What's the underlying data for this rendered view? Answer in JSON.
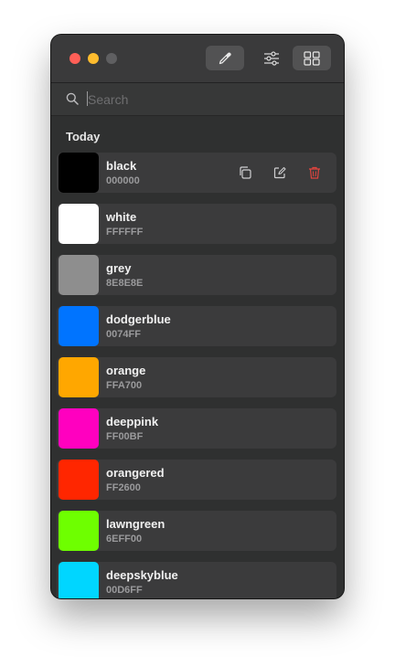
{
  "search": {
    "placeholder": "Search",
    "value": ""
  },
  "section": {
    "title": "Today"
  },
  "colors": [
    {
      "name": "black",
      "hex": "000000",
      "swatch": "#000000"
    },
    {
      "name": "white",
      "hex": "FFFFFF",
      "swatch": "#FFFFFF"
    },
    {
      "name": "grey",
      "hex": "8E8E8E",
      "swatch": "#8E8E8E"
    },
    {
      "name": "dodgerblue",
      "hex": "0074FF",
      "swatch": "#0074FF"
    },
    {
      "name": "orange",
      "hex": "FFA700",
      "swatch": "#FFA700"
    },
    {
      "name": "deeppink",
      "hex": "FF00BF",
      "swatch": "#FF00BF"
    },
    {
      "name": "orangered",
      "hex": "FF2600",
      "swatch": "#FF2600"
    },
    {
      "name": "lawngreen",
      "hex": "6EFF00",
      "swatch": "#6EFF00"
    },
    {
      "name": "deepskyblue",
      "hex": "00D6FF",
      "swatch": "#00D6FF"
    }
  ],
  "icons": {
    "toolbar": [
      "eyedropper-icon",
      "sliders-icon",
      "grid-icon"
    ],
    "row_actions": [
      "copy-icon",
      "edit-icon",
      "trash-icon"
    ]
  },
  "accent": {
    "delete": "#e0443e"
  }
}
